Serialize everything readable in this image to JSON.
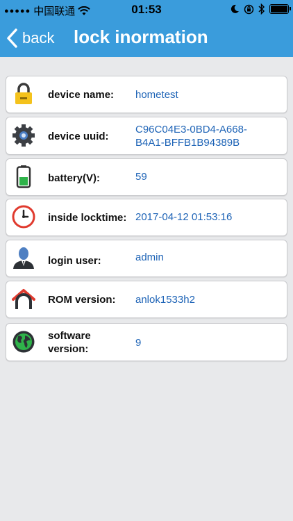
{
  "status_bar": {
    "carrier": "中国联通",
    "time": "01:53"
  },
  "nav": {
    "back_label": "back",
    "title": "lock inormation"
  },
  "rows": [
    {
      "icon": "lock-icon",
      "label": "device name:",
      "value": "hometest"
    },
    {
      "icon": "gear-icon",
      "label": "device uuid:",
      "value_line1": "C96C04E3-0BD4-A668-",
      "value_line2": "B4A1-BFFB1B94389B"
    },
    {
      "icon": "battery-icon",
      "label": "battery(V):",
      "value": "59"
    },
    {
      "icon": "clock-icon",
      "label": "inside locktime:",
      "value": "2017-04-12 01:53:16"
    },
    {
      "icon": "user-icon",
      "label": "login user:",
      "value": "admin"
    },
    {
      "icon": "home-icon",
      "label": "ROM version:",
      "value": "anlok1533h2"
    },
    {
      "icon": "globe-icon",
      "label_line1": "software",
      "label_line2": "version:",
      "value": "9"
    }
  ],
  "colors": {
    "header": "#3a9cdc",
    "value_text": "#1d63b6",
    "background": "#e8e9eb"
  }
}
